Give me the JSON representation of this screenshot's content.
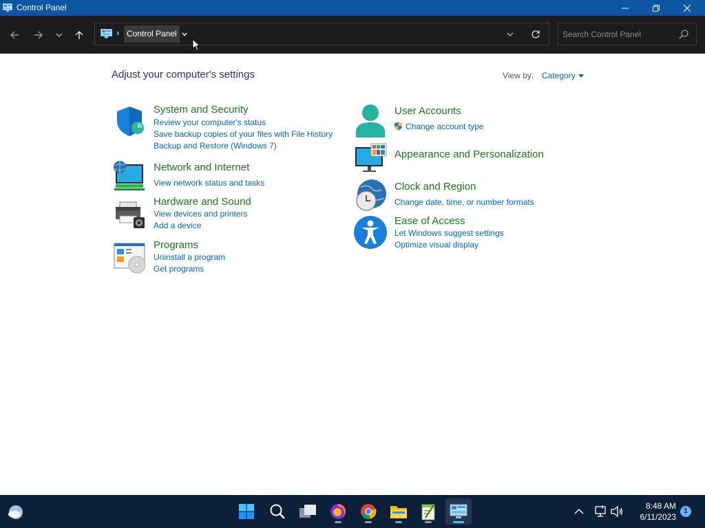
{
  "window": {
    "title": "Control Panel"
  },
  "address": {
    "breadcrumb": "Control Panel",
    "separator": "›"
  },
  "search": {
    "placeholder": "Search Control Panel"
  },
  "main": {
    "heading": "Adjust your computer's settings",
    "view_by_label": "View by:",
    "view_by_value": "Category"
  },
  "categories": {
    "system_security": {
      "title": "System and Security",
      "links": [
        "Review your computer's status",
        "Save backup copies of your files with File History",
        "Backup and Restore (Windows 7)"
      ]
    },
    "network": {
      "title": "Network and Internet",
      "links": [
        "View network status and tasks"
      ]
    },
    "hardware": {
      "title": "Hardware and Sound",
      "links": [
        "View devices and printers",
        "Add a device"
      ]
    },
    "programs": {
      "title": "Programs",
      "links": [
        "Uninstall a program",
        "Get programs"
      ]
    },
    "user_accounts": {
      "title": "User Accounts",
      "links": [
        "Change account type"
      ]
    },
    "appearance": {
      "title": "Appearance and Personalization",
      "links": []
    },
    "clock_region": {
      "title": "Clock and Region",
      "links": [
        "Change date, time, or number formats"
      ]
    },
    "ease": {
      "title": "Ease of Access",
      "links": [
        "Let Windows suggest settings",
        "Optimize visual display"
      ]
    }
  },
  "taskbar": {
    "time": "8:48 AM",
    "date": "6/11/2023",
    "notifications": "1",
    "apps": [
      "start-icon",
      "search-icon",
      "task-view-icon",
      "firefox-icon",
      "chrome-icon",
      "file-explorer-icon",
      "notepad-plus-plus-icon",
      "control-panel-icon"
    ]
  },
  "colors": {
    "title_bar": "#0b55a3",
    "toolbar": "#1c1c1c",
    "heading": "#1e3287",
    "category_title": "#1a7a1a",
    "link": "#0066cc",
    "taskbar": "#0d2039",
    "accent": "#5fb2ff"
  }
}
